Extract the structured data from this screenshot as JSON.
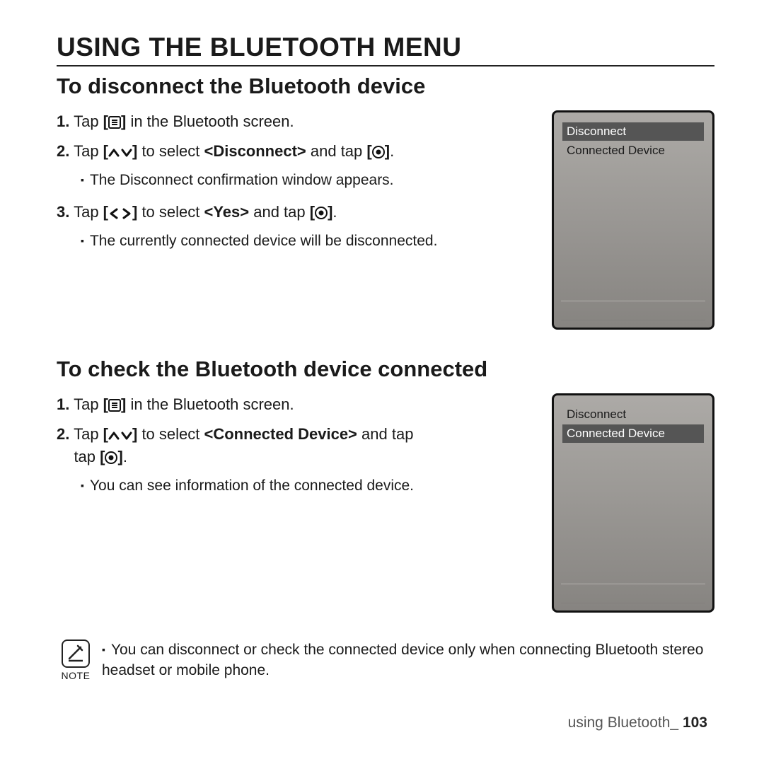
{
  "title": "USING THE BLUETOOTH MENU",
  "section1": {
    "heading": "To disconnect the Bluetooth device",
    "step1_pre": "Tap ",
    "step1_post": " in the Bluetooth screen.",
    "step2_pre": "Tap ",
    "step2_mid": " to select ",
    "step2_sel": "<Disconnect>",
    "step2_andtap": " and tap ",
    "step2_post": ".",
    "step2_bullet": "The Disconnect confirmation window appears.",
    "step3_pre": "Tap ",
    "step3_mid": " to select ",
    "step3_sel": "<Yes>",
    "step3_andtap": " and tap ",
    "step3_post": ".",
    "step3_bullet": "The currently connected device will be disconnected.",
    "device_items": {
      "a": "Disconnect",
      "b": "Connected Device"
    }
  },
  "section2": {
    "heading": "To check the Bluetooth device connected",
    "step1_pre": "Tap ",
    "step1_post": " in the Bluetooth screen.",
    "step2_pre": "Tap ",
    "step2_mid": " to select ",
    "step2_sel": "<Connected Device>",
    "step2_andtap": " and tap ",
    "step2_post": ".",
    "step2_bullet": "You can see information of the connected device.",
    "device_items": {
      "a": "Disconnect",
      "b": "Connected  Device"
    }
  },
  "note": {
    "label": "NOTE",
    "text": "You can disconnect or check the connected device only when connecting Bluetooth stereo headset or mobile phone."
  },
  "footer": {
    "section": "using Bluetooth_ ",
    "page": "103"
  }
}
